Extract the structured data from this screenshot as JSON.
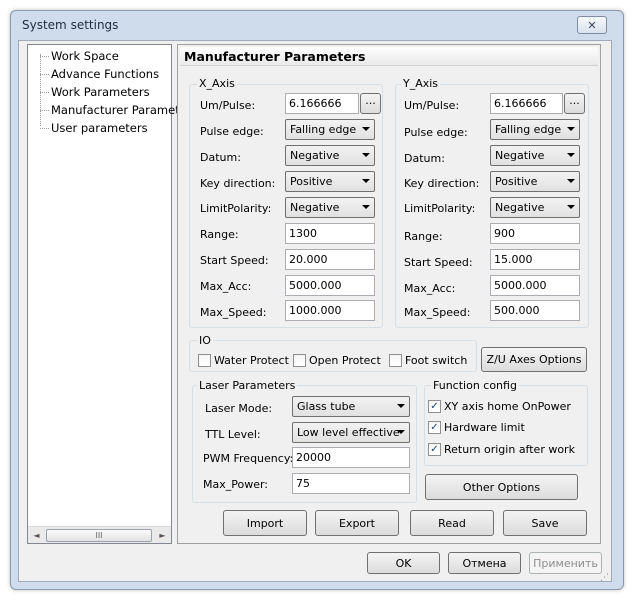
{
  "window": {
    "title": "System settings",
    "close_glyph": "✕"
  },
  "tree": {
    "items": [
      "Work Space",
      "Advance Functions",
      "Work Parameters",
      "Manufacturer Paramet",
      "User parameters"
    ],
    "scroll_thumb": "III",
    "left_arrow": "◄",
    "right_arrow": "►"
  },
  "panel": {
    "title": "Manufacturer Parameters"
  },
  "x_axis": {
    "title": "X_Axis",
    "um_pulse": {
      "label": "Um/Pulse:",
      "value": "6.166666"
    },
    "pulse_edge": {
      "label": "Pulse edge:",
      "value": "Falling edge"
    },
    "datum": {
      "label": "Datum:",
      "value": "Negative"
    },
    "key_direction": {
      "label": "Key direction:",
      "value": "Positive"
    },
    "limit_polarity": {
      "label": "LimitPolarity:",
      "value": "Negative"
    },
    "range": {
      "label": "Range:",
      "value": "1300"
    },
    "start_speed": {
      "label": "Start Speed:",
      "value": "20.000"
    },
    "max_acc": {
      "label": "Max_Acc:",
      "value": "5000.000"
    },
    "max_speed": {
      "label": "Max_Speed:",
      "value": "1000.000"
    }
  },
  "y_axis": {
    "title": "Y_Axis",
    "um_pulse": {
      "label": "Um/Pulse:",
      "value": "6.166666"
    },
    "pulse_edge": {
      "label": "Pulse edge:",
      "value": "Falling edge"
    },
    "datum": {
      "label": "Datum:",
      "value": "Negative"
    },
    "key_direction": {
      "label": "Key direction:",
      "value": "Positive"
    },
    "limit_polarity": {
      "label": "LimitPolarity:",
      "value": "Negative"
    },
    "range": {
      "label": "Range:",
      "value": "900"
    },
    "start_speed": {
      "label": "Start Speed:",
      "value": "15.000"
    },
    "max_acc": {
      "label": "Max_Acc:",
      "value": "5000.000"
    },
    "max_speed": {
      "label": "Max_Speed:",
      "value": "500.000"
    }
  },
  "browse_label": "...",
  "io": {
    "title": "IO",
    "water_protect": {
      "label": "Water Protect",
      "checked": false
    },
    "open_protect": {
      "label": "Open Protect",
      "checked": false
    },
    "foot_switch": {
      "label": "Foot switch",
      "checked": false
    },
    "zu_button": "Z/U Axes Options"
  },
  "laser": {
    "title": "Laser Parameters",
    "laser_mode": {
      "label": "Laser Mode:",
      "value": "Glass tube"
    },
    "ttl_level": {
      "label": "TTL Level:",
      "value": "Low level effective"
    },
    "pwm_frequency": {
      "label": "PWM Frequency:",
      "value": "20000"
    },
    "max_power": {
      "label": "Max_Power:",
      "value": "75"
    }
  },
  "function_config": {
    "title": "Function config",
    "xy_home": {
      "label": "XY axis home OnPower",
      "checked": true
    },
    "hardware_limit": {
      "label": "Hardware limit",
      "checked": true
    },
    "return_origin": {
      "label": "Return origin after work",
      "checked": true
    },
    "other_options": "Other Options"
  },
  "actions": {
    "import": "Import",
    "export": "Export",
    "read": "Read",
    "save": "Save"
  },
  "dialog": {
    "ok": "OK",
    "cancel": "Отмена",
    "apply": "Применить"
  },
  "check_glyph": "✓",
  "colors": {
    "window_frame": "#cfdcec",
    "client_bg": "#f0f0f0",
    "group_border": "#d5dfe5"
  }
}
